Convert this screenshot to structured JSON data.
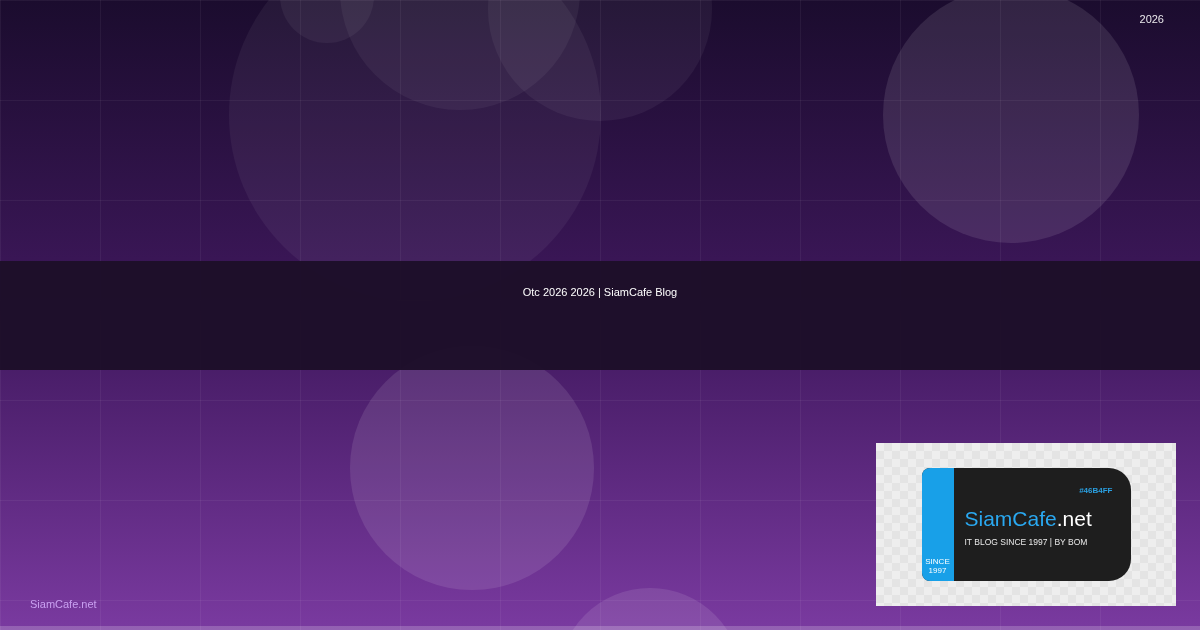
{
  "year_badge": "2026",
  "title": "Otc 2026 2026 | SiamCafe Blog",
  "footer_brand": "SiamCafe.net",
  "logo": {
    "hex_label": "#46B4FF",
    "brand_name": "SiamCafe",
    "brand_suffix": ".net",
    "tagline": "IT BLOG SINCE 1997 | BY BOM",
    "ribbon_line_1": "SINCE",
    "ribbon_line_2": "1997"
  }
}
